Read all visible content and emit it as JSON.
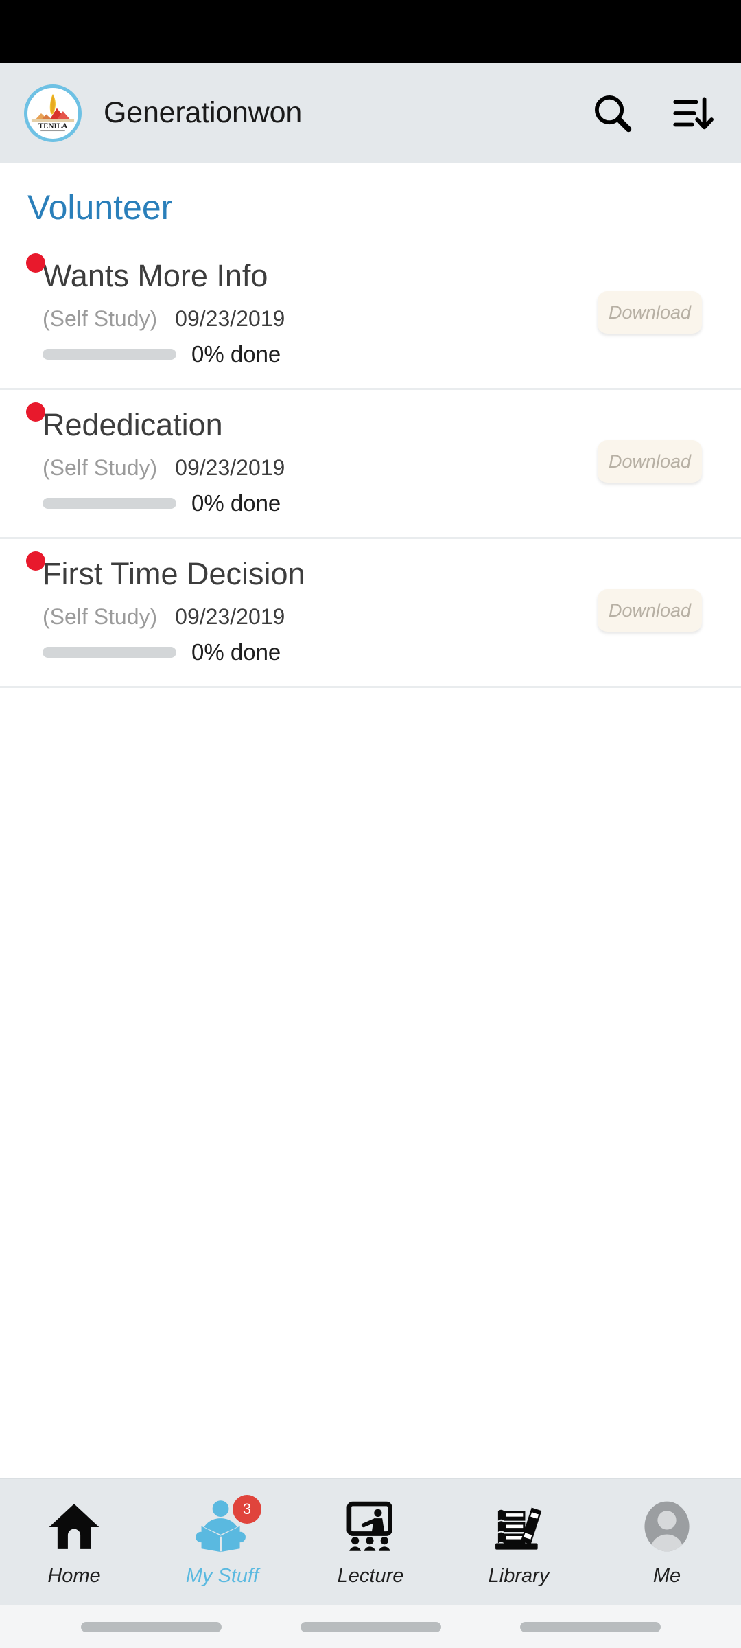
{
  "status_bar": {
    "background": "#000000"
  },
  "app_bar": {
    "logo_alt": "Tenila logo",
    "title": "Generationwon",
    "background": "#e4e8eb",
    "actions": [
      {
        "icon": "search-icon",
        "label": "Search"
      },
      {
        "icon": "sort-descending-icon",
        "label": "Sort"
      }
    ]
  },
  "page": {
    "title": "Volunteer",
    "title_color": "#2a7fba"
  },
  "courses": [
    {
      "status_dot_color": "#e8192c",
      "title": "Wants More Info",
      "type": "(Self Study)",
      "date": "09/23/2019",
      "progress_percent": 0,
      "progress_label": "0% done",
      "action_label": "Download"
    },
    {
      "status_dot_color": "#e8192c",
      "title": "Rededication",
      "type": "(Self Study)",
      "date": "09/23/2019",
      "progress_percent": 0,
      "progress_label": "0% done",
      "action_label": "Download"
    },
    {
      "status_dot_color": "#e8192c",
      "title": "First Time Decision",
      "type": "(Self Study)",
      "date": "09/23/2019",
      "progress_percent": 0,
      "progress_label": "0% done",
      "action_label": "Download"
    }
  ],
  "tab_bar": {
    "active_color": "#5ab9e0",
    "background": "#e4e8eb",
    "items": [
      {
        "icon": "home-icon",
        "label": "Home",
        "active": false,
        "badge": null
      },
      {
        "icon": "person-reading-book-icon",
        "label": "My Stuff",
        "active": true,
        "badge": "3"
      },
      {
        "icon": "lecture-board-icon",
        "label": "Lecture",
        "active": false,
        "badge": null
      },
      {
        "icon": "books-stack-icon",
        "label": "Library",
        "active": false,
        "badge": null
      },
      {
        "icon": "avatar-icon",
        "label": "Me",
        "active": false,
        "badge": null
      }
    ]
  },
  "system_nav": {
    "pill_count": 3
  }
}
